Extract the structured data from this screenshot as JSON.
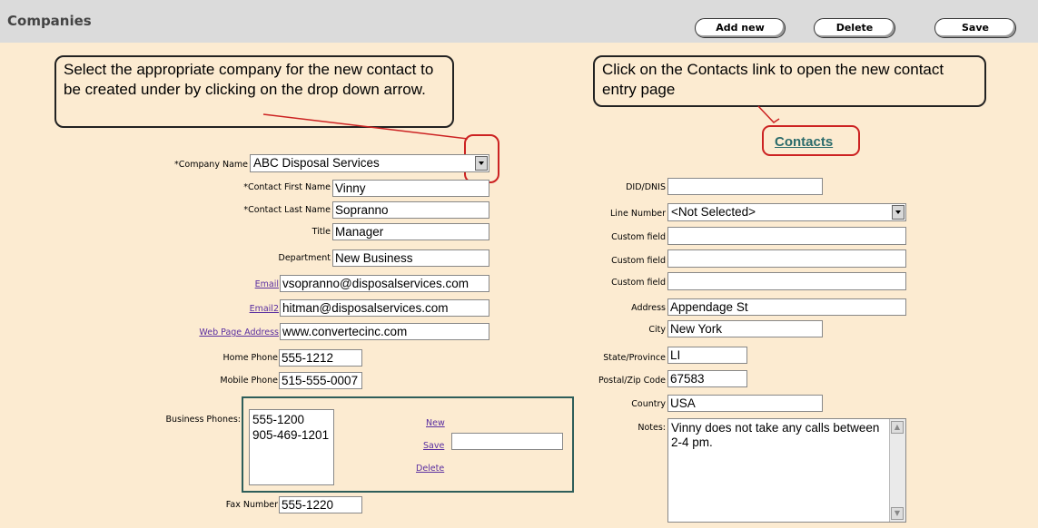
{
  "header": {
    "title": "Companies",
    "buttons": {
      "add_new": "Add new",
      "delete": "Delete",
      "save": "Save"
    }
  },
  "callouts": {
    "left": "Select the appropriate company for the new contact to be created under by clicking on the drop down arrow.",
    "right": "Click on the Contacts link to open the new contact entry page"
  },
  "contacts_link": "Contacts",
  "left_form": {
    "company_name": {
      "label": "*Company Name",
      "value": "ABC Disposal Services"
    },
    "first_name": {
      "label": "*Contact First Name",
      "value": "Vinny"
    },
    "last_name": {
      "label": "*Contact Last Name",
      "value": "Sopranno"
    },
    "title": {
      "label": "Title",
      "value": "Manager"
    },
    "department": {
      "label": "Department",
      "value": "New Business"
    },
    "email": {
      "label": "Email",
      "value": "vsopranno@disposalservices.com"
    },
    "email2": {
      "label": "Email2",
      "value": "hitman@disposalservices.com"
    },
    "web_page": {
      "label": "Web Page Address",
      "value": "www.convertecinc.com"
    },
    "home_phone": {
      "label": "Home Phone",
      "value": "555-1212"
    },
    "mobile_phone": {
      "label": "Mobile Phone",
      "value": "515-555-0007"
    },
    "business_phones": {
      "label": "Business Phones:",
      "list": [
        "555-1200",
        "905-469-1201"
      ],
      "new_link": "New",
      "save_link": "Save",
      "delete_link": "Delete",
      "input_value": ""
    },
    "fax": {
      "label": "Fax Number",
      "value": "555-1220"
    }
  },
  "right_form": {
    "did": {
      "label": "DID/DNIS",
      "value": ""
    },
    "line_number": {
      "label": "Line Number",
      "value": "<Not Selected>"
    },
    "custom1": {
      "label": "Custom field",
      "value": ""
    },
    "custom2": {
      "label": "Custom field",
      "value": ""
    },
    "custom3": {
      "label": "Custom field",
      "value": ""
    },
    "address": {
      "label": "Address",
      "value": "Appendage St"
    },
    "city": {
      "label": "City",
      "value": "New York"
    },
    "state": {
      "label": "State/Province",
      "value": "LI"
    },
    "zip": {
      "label": "Postal/Zip Code",
      "value": "67583"
    },
    "country": {
      "label": "Country",
      "value": "USA"
    },
    "notes": {
      "label": "Notes:",
      "value": "Vinny does not take any calls between 2-4 pm."
    }
  },
  "colors": {
    "header_bg": "#dbdbdb",
    "main_bg": "#fcebd1",
    "highlight": "#cc2222",
    "box_border": "#2e5e5a"
  }
}
